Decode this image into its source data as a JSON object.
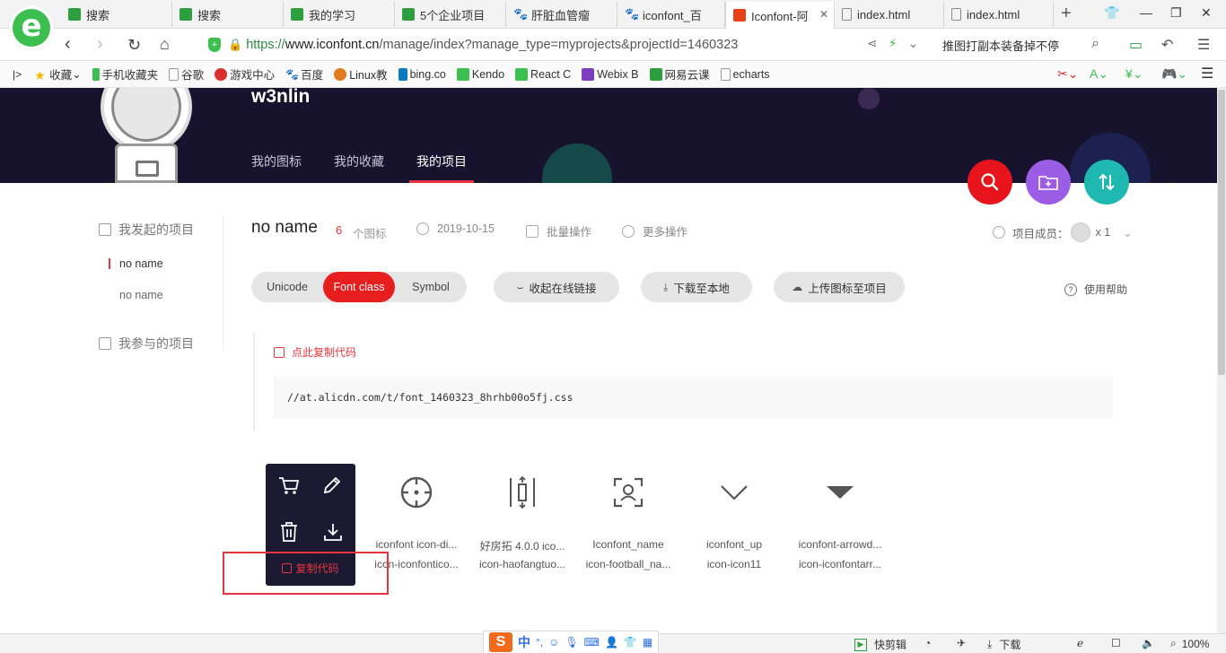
{
  "browser": {
    "logo_letter": "e",
    "tabs": [
      {
        "label": "搜索",
        "icon": "green-book-icon"
      },
      {
        "label": "搜索",
        "icon": "green-book-icon"
      },
      {
        "label": "我的学习",
        "icon": "green-book-icon"
      },
      {
        "label": "5个企业项目",
        "icon": "green-book-icon"
      },
      {
        "label": "肝脏血管瘤",
        "icon": "baidu-paw-icon"
      },
      {
        "label": "iconfont_百",
        "icon": "baidu-paw-icon"
      },
      {
        "label": "Iconfont-阿",
        "icon": "iconfont-icon"
      },
      {
        "label": "index.html",
        "icon": "file-icon"
      },
      {
        "label": "index.html",
        "icon": "file-icon"
      }
    ],
    "url_scheme": "https://",
    "url_domain": "www.iconfont.cn",
    "url_path": "/manage/index?manage_type=myprojects&projectId=1460323",
    "search_text": "推图打副本装备掉不停",
    "bookmarks": [
      {
        "label": "收藏",
        "color": "#f5b800"
      },
      {
        "label": "手机收藏夹",
        "color": "#3dbf4f"
      },
      {
        "label": "谷歌",
        "color": "#999999"
      },
      {
        "label": "游戏中心",
        "color": "#d9302c"
      },
      {
        "label": "百度",
        "color": "#2f6fe0"
      },
      {
        "label": "Linux教",
        "color": "#e07a1f"
      },
      {
        "label": "bing.co",
        "color": "#0a7bbf"
      },
      {
        "label": "Kendo",
        "color": "#3dbf4f"
      },
      {
        "label": "React C",
        "color": "#3dbf4f"
      },
      {
        "label": "Webix B",
        "color": "#7a3fbf"
      },
      {
        "label": "网易云课",
        "color": "#2e9e3e"
      },
      {
        "label": "echarts",
        "color": "#999999"
      }
    ]
  },
  "header": {
    "username": "w3nlin",
    "nav": [
      {
        "label": "我的图标",
        "active": false
      },
      {
        "label": "我的收藏",
        "active": false
      },
      {
        "label": "我的项目",
        "active": true
      }
    ]
  },
  "sidebar": {
    "section1": "我发起的项目",
    "items": [
      {
        "label": "no name",
        "active": true
      },
      {
        "label": "no name",
        "active": false
      }
    ],
    "section2": "我参与的项目"
  },
  "project": {
    "title": "no name",
    "count": "6",
    "count_label": "个图标",
    "date": "2019-10-15",
    "batch": "批量操作",
    "more": "更多操作",
    "members_label": "项目成员：",
    "members_count": "x 1",
    "tabs": [
      {
        "label": "Unicode",
        "active": false
      },
      {
        "label": "Font class",
        "active": true
      },
      {
        "label": "Symbol",
        "active": false
      }
    ],
    "collapse_link": "收起在线链接",
    "download": "下载至本地",
    "upload": "上传图标至项目",
    "help": "使用帮助",
    "copy_code": "点此复制代码",
    "code": "//at.alicdn.com/t/font_1460323_8hrhb00o5fj.css"
  },
  "icons": [
    {
      "name": "",
      "class": "",
      "glyph": "hover-icon"
    },
    {
      "name": "iconfont icon-di...",
      "class": "icon-iconfontico...",
      "glyph": "crosshair-icon"
    },
    {
      "name": "好房拓 4.0.0 ico...",
      "class": "icon-haofangtuo...",
      "glyph": "split-arrows-icon"
    },
    {
      "name": "Iconfont_name",
      "class": "icon-football_na...",
      "glyph": "scan-user-icon"
    },
    {
      "name": "iconfont_up",
      "class": "icon-icon11",
      "glyph": "chevron-down-icon"
    },
    {
      "name": "iconfont-arrowd...",
      "class": "icon-iconfontarr...",
      "glyph": "triangle-down-icon"
    }
  ],
  "hover_panel": {
    "copy_label": "复制代码"
  },
  "statusbar": {
    "ime_mode": "中",
    "clip_label": "快剪辑",
    "download_label": "下载",
    "zoom": "100%"
  },
  "colors": {
    "accent": "#e8343f",
    "hero_bg": "#17132e",
    "fab_search": "#e8141b",
    "fab_add": "#9b5de5",
    "fab_sort": "#1fb8b0"
  }
}
